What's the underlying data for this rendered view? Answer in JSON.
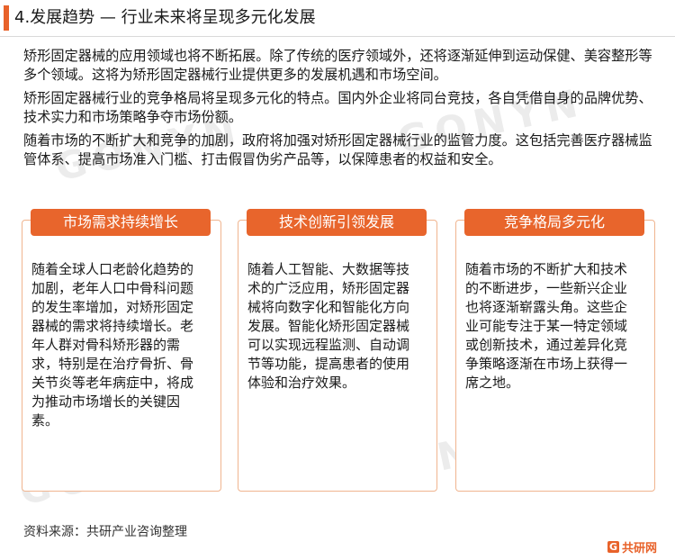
{
  "header": {
    "title": "4.发展趋势 — 行业未来将呈现多元化发展"
  },
  "paragraphs": [
    "矫形固定器械的应用领域也将不断拓展。除了传统的医疗领域外，还将逐渐延伸到运动保健、美容整形等多个领域。这将为矫形固定器械行业提供更多的发展机遇和市场空间。",
    "矫形固定器械行业的竞争格局将呈现多元化的特点。国内外企业将同台竞技，各自凭借自身的品牌优势、技术实力和市场策略争夺市场份额。",
    "随着市场的不断扩大和竞争的加剧，政府将加强对矫形固定器械行业的监管力度。这包括完善医疗器械监管体系、提高市场准入门槛、打击假冒伪劣产品等，以保障患者的权益和安全。"
  ],
  "cards": [
    {
      "title": "市场需求持续增长",
      "body": "随着全球人口老龄化趋势的加剧，老年人口中骨科问题的发生率增加，对矫形固定器械的需求将持续增长。老年人群对骨科矫形器的需求，特别是在治疗骨折、骨关节炎等老年病症中，将成为推动市场增长的关键因素。"
    },
    {
      "title": "技术创新引领发展",
      "body": "随着人工智能、大数据等技术的广泛应用，矫形固定器械将向数字化和智能化方向发展。智能化矫形固定器械可以实现远程监测、自动调节等功能，提高患者的使用体验和治疗效果。"
    },
    {
      "title": "竞争格局多元化",
      "body": "随着市场的不断扩大和技术的不断进步，一些新兴企业也将逐渐崭露头角。这些企业可能专注于某一特定领域或创新技术，通过差异化竞争策略逐渐在市场上获得一席之地。"
    }
  ],
  "source": "资料来源：共研产业咨询整理",
  "logo": {
    "mark": "G",
    "text": "共研网"
  },
  "colors": {
    "accent": "#e8622a",
    "card_border": "#f0b48f"
  }
}
